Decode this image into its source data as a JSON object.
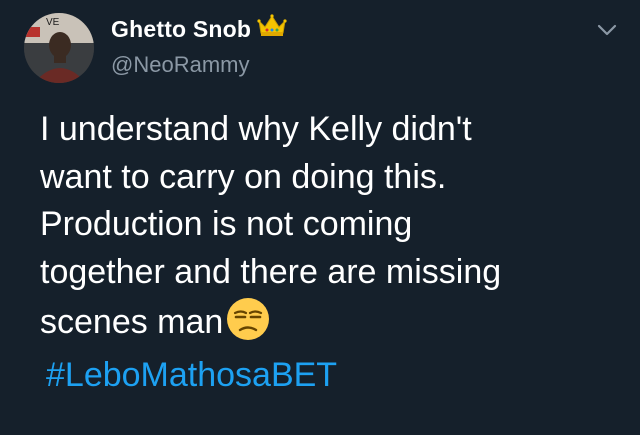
{
  "tweet": {
    "display_name": "Ghetto Snob",
    "handle": "@NeoRammy",
    "text_lines": [
      "I understand why Kelly didn't",
      "want to carry on doing this.",
      "Production is not coming",
      "together and there are missing",
      "scenes man"
    ],
    "hashtag": "#LeboMathosaBET",
    "avatar_banner_text": "VE",
    "badge_icon": "crown-icon",
    "emoji_icon": "unamused-face-emoji",
    "menu_icon": "chevron-down-icon"
  },
  "colors": {
    "background": "#15202b",
    "text": "#ffffff",
    "secondary_text": "#8b98a5",
    "hashtag": "#1da1f2",
    "crown": "#f5c400"
  }
}
